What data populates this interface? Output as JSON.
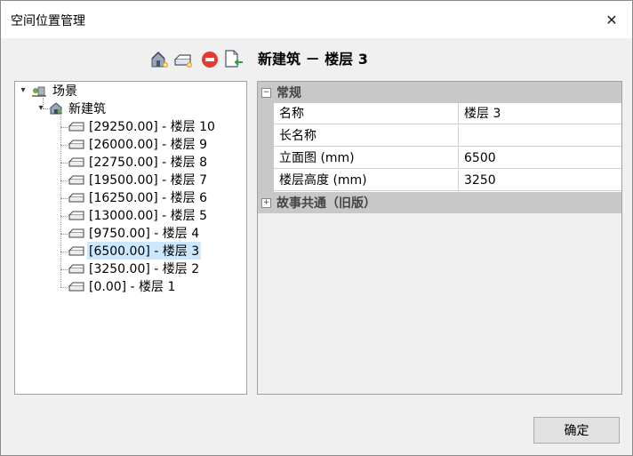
{
  "window": {
    "title": "空间位置管理",
    "close_glyph": "✕"
  },
  "toolbar": {
    "buttons": [
      {
        "name": "add-building-icon"
      },
      {
        "name": "add-level-icon"
      },
      {
        "name": "delete-icon"
      },
      {
        "name": "import-icon"
      }
    ]
  },
  "tree": {
    "root": {
      "label": "场景",
      "expander": "▾"
    },
    "building": {
      "label": "新建筑",
      "expander": "▾"
    },
    "levels": [
      {
        "label": "[29250.00] - 楼层 10"
      },
      {
        "label": "[26000.00] - 楼层 9"
      },
      {
        "label": "[22750.00] - 楼层 8"
      },
      {
        "label": "[19500.00] - 楼层 7"
      },
      {
        "label": "[16250.00] - 楼层 6"
      },
      {
        "label": "[13000.00] - 楼层 5"
      },
      {
        "label": "[9750.00] - 楼层 4"
      },
      {
        "label": "[6500.00] - 楼层 3",
        "selected": true
      },
      {
        "label": "[3250.00] - 楼层 2"
      },
      {
        "label": "[0.00] - 楼层 1"
      }
    ]
  },
  "properties": {
    "title": "新建筑 － 楼层 3",
    "categories": [
      {
        "name": "常规",
        "toggle": "−",
        "expanded": true,
        "rows": [
          {
            "name": "名称",
            "value": "楼层 3"
          },
          {
            "name": "长名称",
            "value": ""
          },
          {
            "name": "立面图 (mm)",
            "value": "6500"
          },
          {
            "name": "楼层高度 (mm)",
            "value": "3250"
          }
        ]
      },
      {
        "name": "故事共通（旧版）",
        "toggle": "+",
        "expanded": false,
        "rows": []
      }
    ]
  },
  "footer": {
    "ok_label": "确定"
  },
  "colors": {
    "selection": "#cce8ff",
    "category_bg": "#c8c8c8",
    "delete_red": "#e53935",
    "import_green": "#2e9e3a"
  }
}
